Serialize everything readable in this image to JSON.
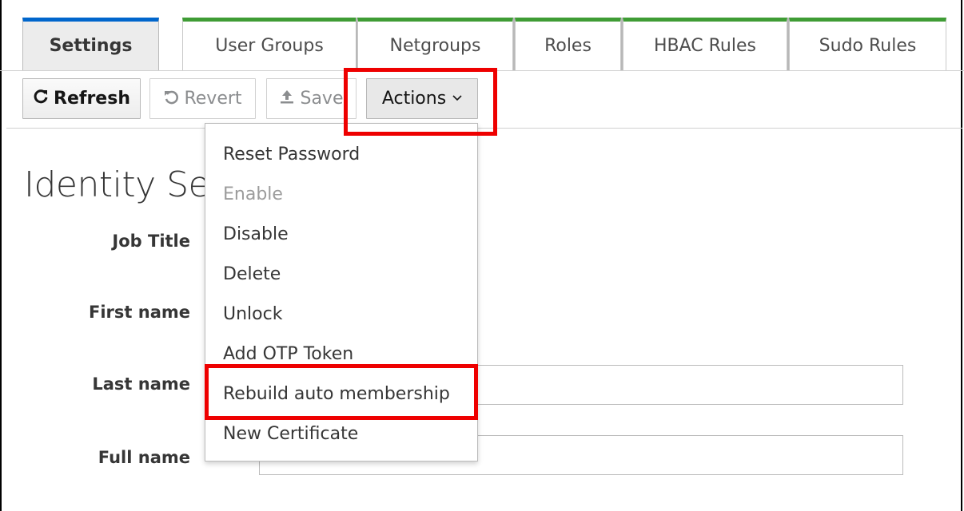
{
  "tabs": [
    {
      "label": "Settings",
      "active": true
    },
    {
      "label": "User Groups",
      "active": false
    },
    {
      "label": "Netgroups",
      "active": false
    },
    {
      "label": "Roles",
      "active": false
    },
    {
      "label": "HBAC Rules",
      "active": false
    },
    {
      "label": "Sudo Rules",
      "active": false
    }
  ],
  "toolbar": {
    "refresh_label": "Refresh",
    "revert_label": "Revert",
    "save_label": "Save",
    "actions_label": "Actions"
  },
  "icons": {
    "refresh": "refresh-icon",
    "revert": "undo-icon",
    "save": "upload-icon",
    "actions": "chevron-down-icon"
  },
  "page": {
    "title": "Identity Set"
  },
  "fields": [
    {
      "label": "Job Title"
    },
    {
      "label": "First name"
    },
    {
      "label": "Last name"
    },
    {
      "label": "Full name"
    }
  ],
  "actions_menu": {
    "items": [
      {
        "label": "Reset Password",
        "disabled": false
      },
      {
        "label": "Enable",
        "disabled": true
      },
      {
        "label": "Disable",
        "disabled": false
      },
      {
        "label": "Delete",
        "disabled": false
      },
      {
        "label": "Unlock",
        "disabled": false
      },
      {
        "label": "Add OTP Token",
        "disabled": false
      },
      {
        "label": "Rebuild auto membership",
        "disabled": false,
        "highlighted": true
      },
      {
        "label": "New Certificate",
        "disabled": false
      }
    ]
  },
  "colors": {
    "active_tab_accent": "#0066cc",
    "inactive_tab_accent": "#3f9c35",
    "annotation": "#ee0000"
  }
}
